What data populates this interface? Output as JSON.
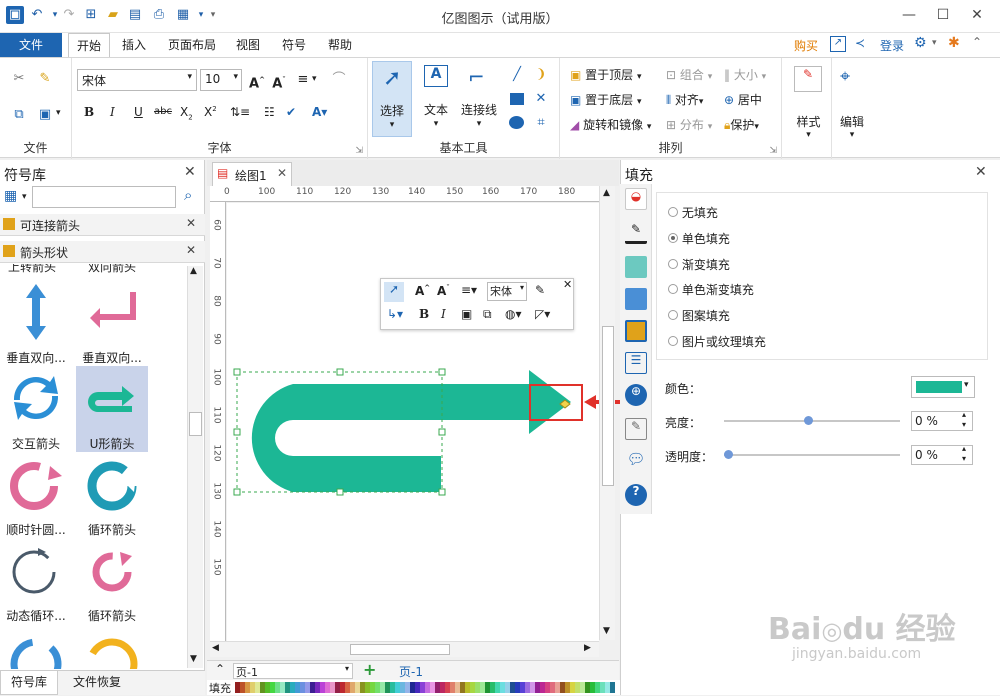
{
  "app": {
    "title": "亿图图示（试用版）"
  },
  "menu": {
    "file": "文件",
    "tabs": [
      "开始",
      "插入",
      "页面布局",
      "视图",
      "符号",
      "帮助"
    ],
    "right": {
      "buy": "购买",
      "login": "登录"
    }
  },
  "ribbon": {
    "font": {
      "name": "宋体",
      "size": "10",
      "group_label": "字体"
    },
    "file_group_label": "文件",
    "tools": {
      "select": "选择",
      "text": "文本",
      "connector": "连接线",
      "group_label": "基本工具"
    },
    "arrange": {
      "bring_front": "置于顶层",
      "send_back": "置于底层",
      "rotate": "旋转和镜像",
      "group": "组合",
      "align": "对齐",
      "distribute": "分布",
      "size": "大小",
      "center": "居中",
      "protect": "保护",
      "group_label": "排列"
    },
    "style": "样式",
    "edit": "编辑"
  },
  "left_panel": {
    "title": "符号库",
    "section1": "可连接箭头",
    "section2": "箭头形状",
    "partial_labels": [
      "上转箭头",
      "双向箭头"
    ],
    "symbols": [
      "垂直双向...",
      "垂直双向...",
      "交互箭头",
      "U形箭头",
      "顺时针圆...",
      "循环箭头",
      "动态循环...",
      "循环箭头"
    ],
    "bottom_tabs": [
      "符号库",
      "文件恢复"
    ]
  },
  "canvas": {
    "doc_tab": "绘图1",
    "h_ruler": [
      "0",
      "100",
      "110",
      "120",
      "130",
      "140",
      "150",
      "160",
      "170",
      "180"
    ],
    "v_ruler": [
      "60",
      "70",
      "80",
      "90",
      "100",
      "110",
      "120",
      "130",
      "140",
      "150"
    ],
    "page_name": "页-1",
    "page_tab": "页-1",
    "fill_label": "填充",
    "float_font": "宋体"
  },
  "fill_panel": {
    "title": "填充",
    "options": [
      "无填充",
      "单色填充",
      "渐变填充",
      "单色渐变填充",
      "图案填充",
      "图片或纹理填充"
    ],
    "selected": "单色填充",
    "color_label": "颜色：",
    "brightness_label": "亮度：",
    "brightness_value": "0 %",
    "brightness_level": 0.48,
    "transparency_label": "透明度：",
    "transparency_value": "0 %",
    "transparency_level": 0.0
  },
  "colors": {
    "shape": "#1cb795",
    "accent": "#1e65b1",
    "highlight": "#e0312a",
    "fill_swatch": "#1cb795"
  },
  "watermark": {
    "logo": "Baidu 经验",
    "url": "jingyan.baidu.com"
  }
}
